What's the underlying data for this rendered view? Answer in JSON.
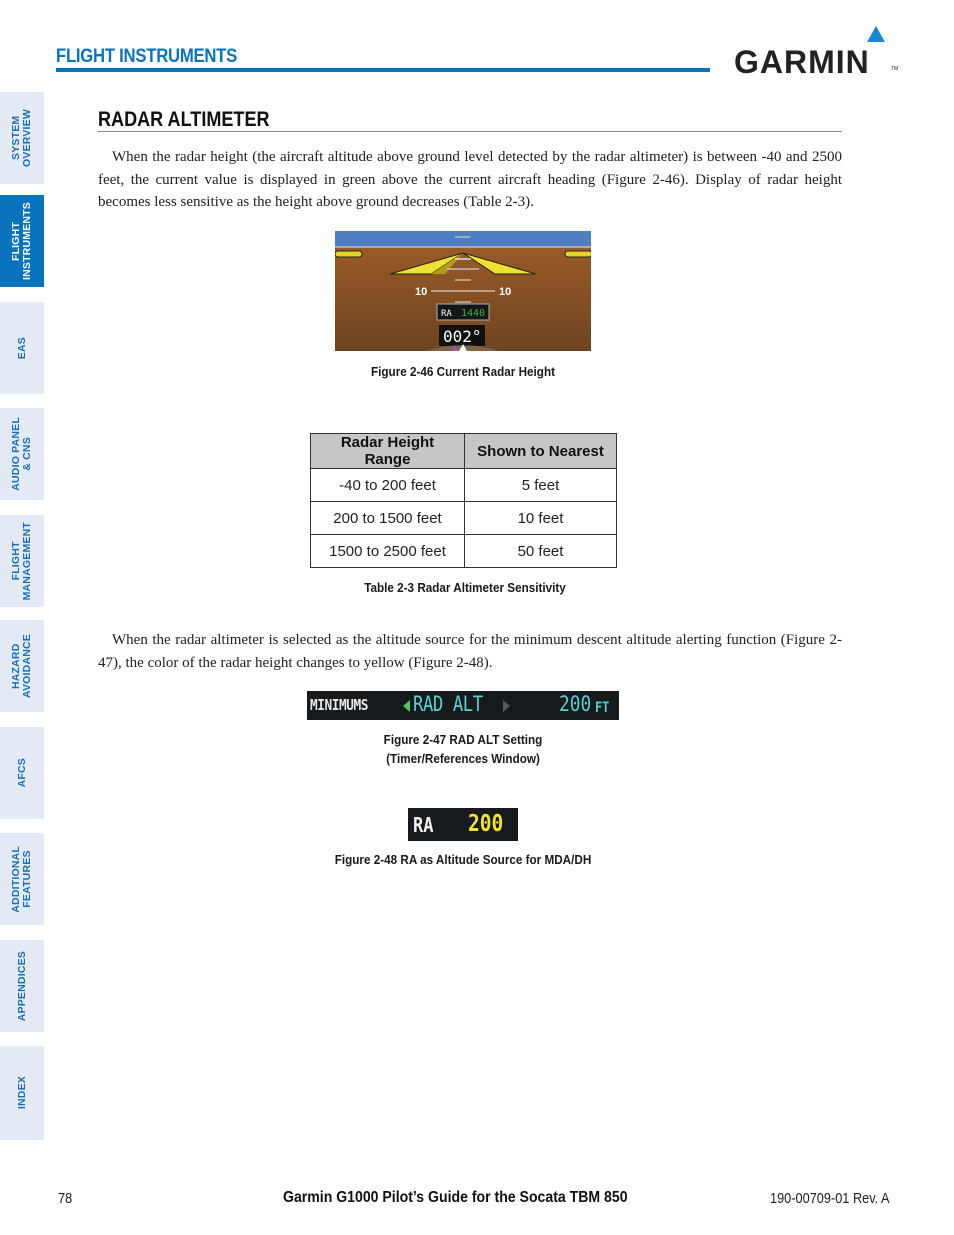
{
  "side_tabs": [
    {
      "label": "SYSTEM\nOVERVIEW",
      "active": false
    },
    {
      "label": "FLIGHT\nINSTRUMENTS",
      "active": true
    },
    {
      "label": "EAS",
      "active": false
    },
    {
      "label": "AUDIO PANEL\n& CNS",
      "active": false
    },
    {
      "label": "FLIGHT\nMANAGEMENT",
      "active": false
    },
    {
      "label": "HAZARD\nAVOIDANCE",
      "active": false
    },
    {
      "label": "AFCS",
      "active": false
    },
    {
      "label": "ADDITIONAL\nFEATURES",
      "active": false
    },
    {
      "label": "APPENDICES",
      "active": false
    },
    {
      "label": "INDEX",
      "active": false
    }
  ],
  "header": {
    "section": "FLIGHT INSTRUMENTS",
    "logo": "GARMIN",
    "logo_tm": "TM",
    "accent_color": "#0a73bd"
  },
  "subsection": {
    "title": "RADAR ALTIMETER"
  },
  "paragraphs": [
    "When the radar height (the aircraft altitude above ground level detected by the radar altimeter) is between -40 and 2500 feet, the current value is displayed in green above the current aircraft heading (Figure 2-46).  Display of radar height becomes less sensitive as the height above ground decreases (Table 2-3).",
    "When the radar altimeter is selected as the altitude source for the minimum descent altitude alerting function (Figure 2-47), the color of the radar height changes to yellow (Figure 2-48)."
  ],
  "figure_2_46": {
    "caption": "Figure 2-46  Current Radar Height",
    "pitch_left": "10",
    "pitch_right": "10",
    "ra_label": "RA",
    "ra_value": "1440",
    "ra_color": "#3fae4c",
    "heading": "002°"
  },
  "table": {
    "caption": "Table 2-3  Radar Altimeter Sensitivity",
    "headers": [
      "Radar Height Range",
      "Shown to Nearest"
    ],
    "rows": [
      [
        "-40 to 200 feet",
        "5 feet"
      ],
      [
        "200 to 1500 feet",
        "10 feet"
      ],
      [
        "1500 to 2500 feet",
        "50 feet"
      ]
    ]
  },
  "figure_2_47": {
    "caption_line1": "Figure 2-47  RAD ALT Setting",
    "caption_line2": "(Timer/References Window)",
    "label": "MINIMUMS",
    "value": "RAD ALT",
    "altitude": "200",
    "unit": "FT"
  },
  "figure_2_48": {
    "caption": "Figure 2-48  RA as Altitude Source for MDA/DH",
    "label": "RA",
    "value": "200",
    "value_color": "#f2e22a"
  },
  "footer": {
    "page_number": "78",
    "title": "Garmin G1000 Pilot’s Guide for the Socata TBM 850",
    "doc_number": "190-00709-01  Rev. A"
  }
}
